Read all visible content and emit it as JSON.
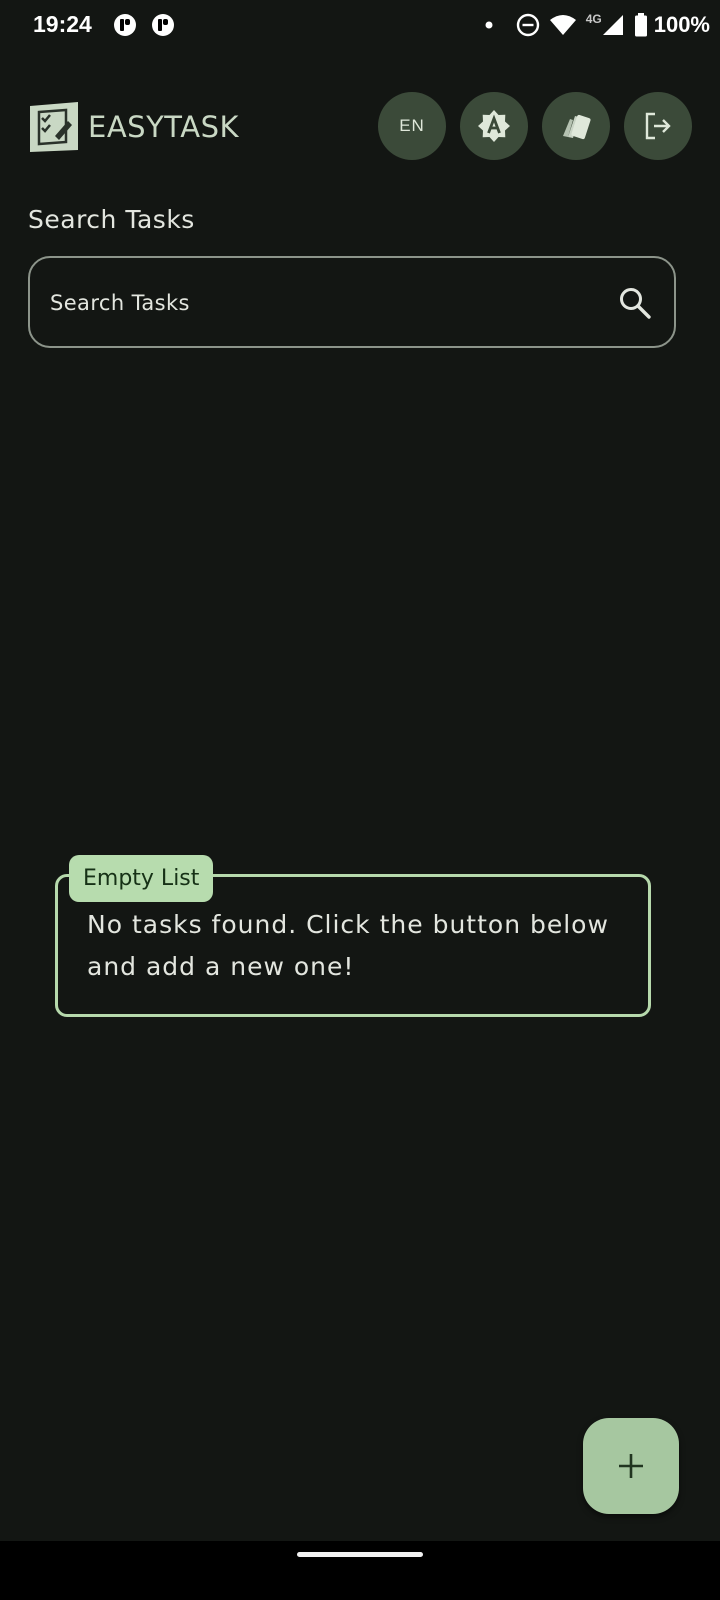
{
  "status_bar": {
    "time": "19:24",
    "network_type": "4G",
    "battery_percent": "100%"
  },
  "header": {
    "app_name": "EASYTASK",
    "language_label": "EN",
    "actions": [
      "language-button",
      "brightness-auto-icon",
      "theme-palette-icon",
      "logout-icon"
    ]
  },
  "search": {
    "section_title": "Search Tasks",
    "placeholder": "Search Tasks",
    "value": ""
  },
  "empty_state": {
    "badge": "Empty List",
    "message": "No tasks found. Click the button below and add a new one!"
  },
  "colors": {
    "background": "#131613",
    "accent": "#b7dcae",
    "fab": "#a6c7a0",
    "button_bg": "#3b4a39"
  }
}
